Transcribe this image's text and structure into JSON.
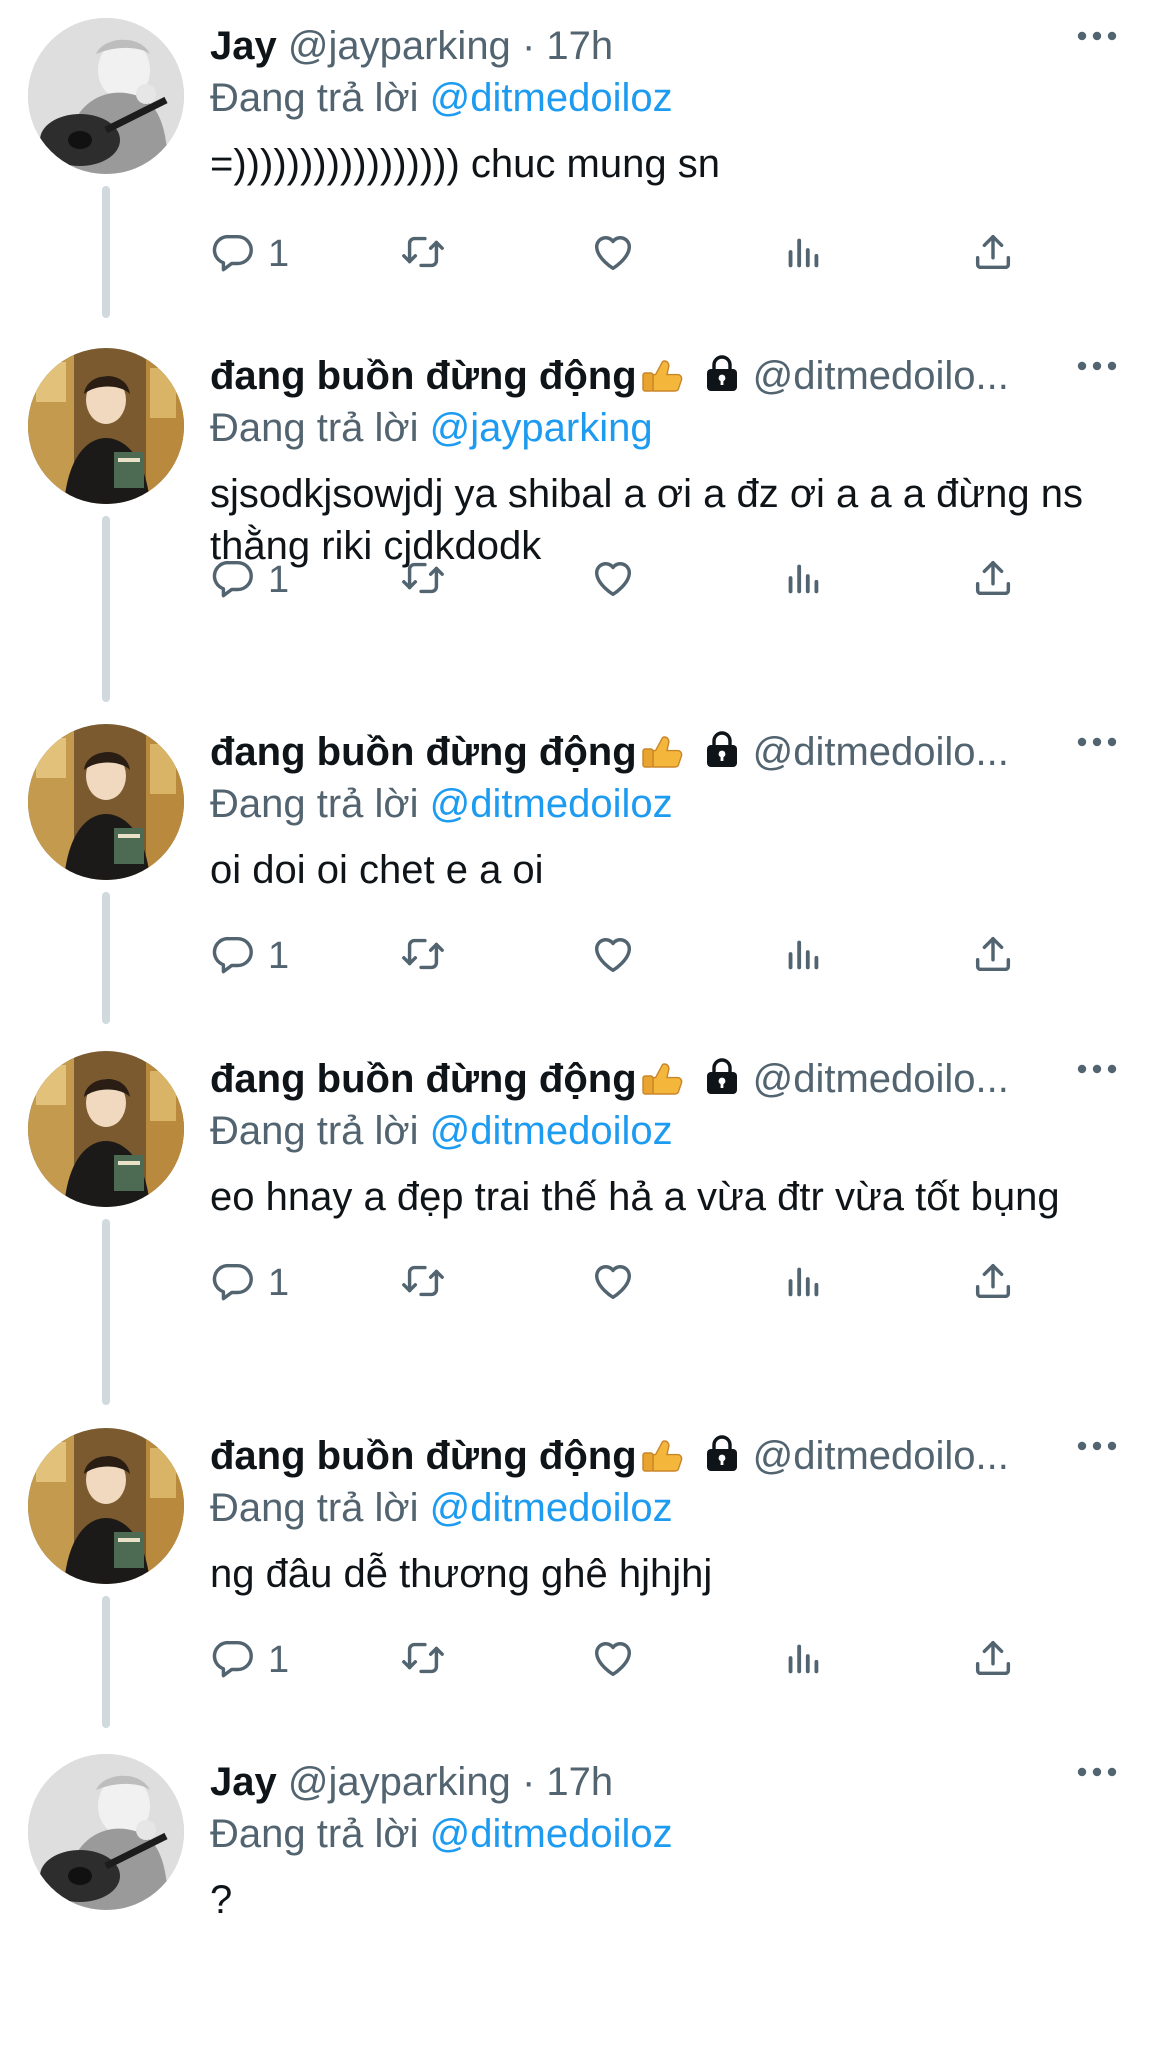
{
  "labels": {
    "replying_prefix": "Đang trả lời"
  },
  "colors": {
    "text": "#0f1419",
    "secondary": "#536471",
    "link": "#1d9bf0",
    "thread_line": "#cfd9de"
  },
  "tweets": [
    {
      "user": "jay",
      "name": "Jay",
      "handle": "@jayparking",
      "time": "· 17h",
      "reply_to": "@ditmedoiloz",
      "text": "=))))))))))))))))) chuc mung sn",
      "reply_count": "1"
    },
    {
      "user": "ditme",
      "name": "đang buồn đừng động",
      "handle": "@ditmedoilo...",
      "time": "",
      "reply_to": "@jayparking",
      "text": "sjsodkjsowjdj ya shibal a ơi a đz ơi a a a đừng ns thằng riki cjdkdodk",
      "reply_count": "1"
    },
    {
      "user": "ditme",
      "name": "đang buồn đừng động",
      "handle": "@ditmedoilo...",
      "time": "",
      "reply_to": "@ditmedoiloz",
      "text": "oi doi oi chet e a oi",
      "reply_count": "1"
    },
    {
      "user": "ditme",
      "name": "đang buồn đừng động",
      "handle": "@ditmedoilo...",
      "time": "",
      "reply_to": "@ditmedoiloz",
      "text": "eo hnay a đẹp trai thế hả a vừa đtr vừa tốt bụng",
      "reply_count": "1"
    },
    {
      "user": "ditme",
      "name": "đang buồn đừng động",
      "handle": "@ditmedoilo...",
      "time": "",
      "reply_to": "@ditmedoiloz",
      "text": "ng đâu dễ thương ghê hjhjhj",
      "reply_count": "1"
    },
    {
      "user": "jay",
      "name": "Jay",
      "handle": "@jayparking",
      "time": "· 17h",
      "reply_to": "@ditmedoiloz",
      "text": "?",
      "reply_count": ""
    }
  ]
}
